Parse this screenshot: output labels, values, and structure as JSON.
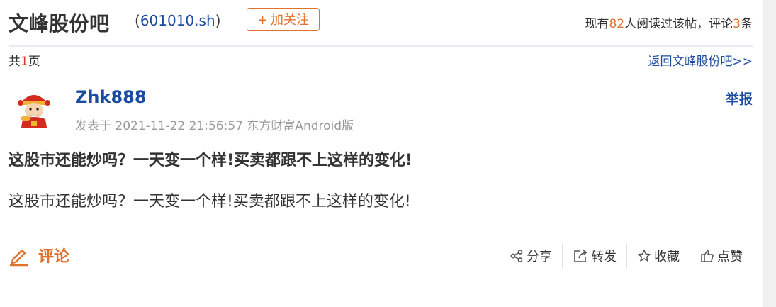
{
  "header": {
    "bar_name": "文峰股份吧",
    "code_open": "(",
    "code": "601010.sh",
    "code_close": ")",
    "follow_label": "加关注",
    "follow_plus": "+",
    "stats_prefix": "现有",
    "read_count": "82",
    "stats_mid": "人阅读过该帖，评论",
    "comment_count": "3",
    "stats_suffix": "条"
  },
  "subrow": {
    "pages_prefix": "共",
    "page_count": "1",
    "pages_suffix": "页",
    "back_link": "返回文峰股份吧>>"
  },
  "author": {
    "name": "Zhk888",
    "meta": "发表于 2021-11-22 21:56:57 东方财富Android版",
    "report_label": "举报"
  },
  "post": {
    "title": "这股市还能炒吗？一天变一个样!买卖都跟不上这样的变化!",
    "body": "这股市还能炒吗？一天变一个样!买卖都跟不上这样的变化!"
  },
  "footer": {
    "comment_label": "评论",
    "actions": [
      {
        "label": "分享",
        "icon": "share-icon"
      },
      {
        "label": "转发",
        "icon": "forward-icon"
      },
      {
        "label": "收藏",
        "icon": "star-icon"
      },
      {
        "label": "点赞",
        "icon": "thumbs-up-icon"
      }
    ]
  },
  "colors": {
    "accent_orange": "#e0712f",
    "link_blue": "#1c4ca0",
    "highlight_red": "#e0302f",
    "meta_gray": "#999999"
  }
}
